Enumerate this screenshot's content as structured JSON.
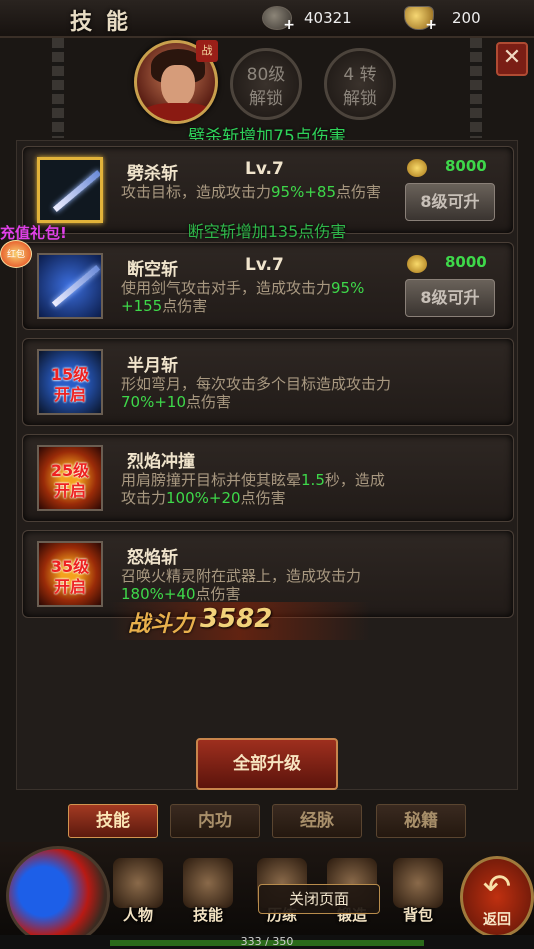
{
  "header": {
    "title": "技能",
    "silver": {
      "icon": "silver-coin-icon",
      "value": "40321",
      "plus": "+"
    },
    "gold": {
      "icon": "gold-ingot-icon",
      "value": "200",
      "plus": "+"
    },
    "close_label": "✕"
  },
  "hero": {
    "badge": "战",
    "lock1": {
      "line1": "80级",
      "line2": "解锁"
    },
    "lock2": {
      "line1": "4 转",
      "line2": "解锁"
    }
  },
  "hints": {
    "top": "劈杀斩增加75点伤害",
    "mid": "断空斩增加135点伤害"
  },
  "gift": {
    "label": "充值礼包!",
    "badge": "红包"
  },
  "skills": [
    {
      "name": "劈杀斩",
      "level": "Lv.7",
      "desc_a": "攻击目标，造成攻击力",
      "g1": "95%+85",
      "desc_b": "点伤害",
      "cost": "8000",
      "upgrade": "8级可升",
      "lock": ""
    },
    {
      "name": "断空斩",
      "level": "Lv.7",
      "desc_a": "使用剑气攻击对手，造成攻击力",
      "g1": "95%",
      "g1b": "+155",
      "desc_b": "点伤害",
      "cost": "8000",
      "upgrade": "8级可升",
      "lock": ""
    },
    {
      "name": "半月斩",
      "level": "",
      "desc_a": "形如弯月，每次攻击多个目标造成攻击力",
      "g1": "70%+10",
      "desc_b": "点伤害",
      "lock1": "15级",
      "lock2": "开启"
    },
    {
      "name": "烈焰冲撞",
      "level": "",
      "desc_a": "用肩膀撞开目标并使其眩晕",
      "g0": "1.5",
      "desc_a2": "秒，造成攻击力",
      "g1": "100%+20",
      "desc_b": "点伤害",
      "lock1": "25级",
      "lock2": "开启"
    },
    {
      "name": "怒焰斩",
      "level": "",
      "desc_a": "召唤火精灵附在武器上，造成攻击力",
      "g1": "180%+40",
      "desc_b": "点伤害",
      "lock1": "35级",
      "lock2": "开启"
    }
  ],
  "power": {
    "label": "战斗力",
    "value": "3582"
  },
  "actions": {
    "upgrade_all": "全部升级"
  },
  "tabs": [
    "技能",
    "内功",
    "经脉",
    "秘籍"
  ],
  "bottom_nav": [
    "人物",
    "技能",
    "历练",
    "锻造",
    "背包"
  ],
  "close_page": "关闭页面",
  "back": {
    "label": "返回",
    "arrow": "↶"
  },
  "exp": {
    "text": "333 / 350",
    "fraction": 0.951
  }
}
